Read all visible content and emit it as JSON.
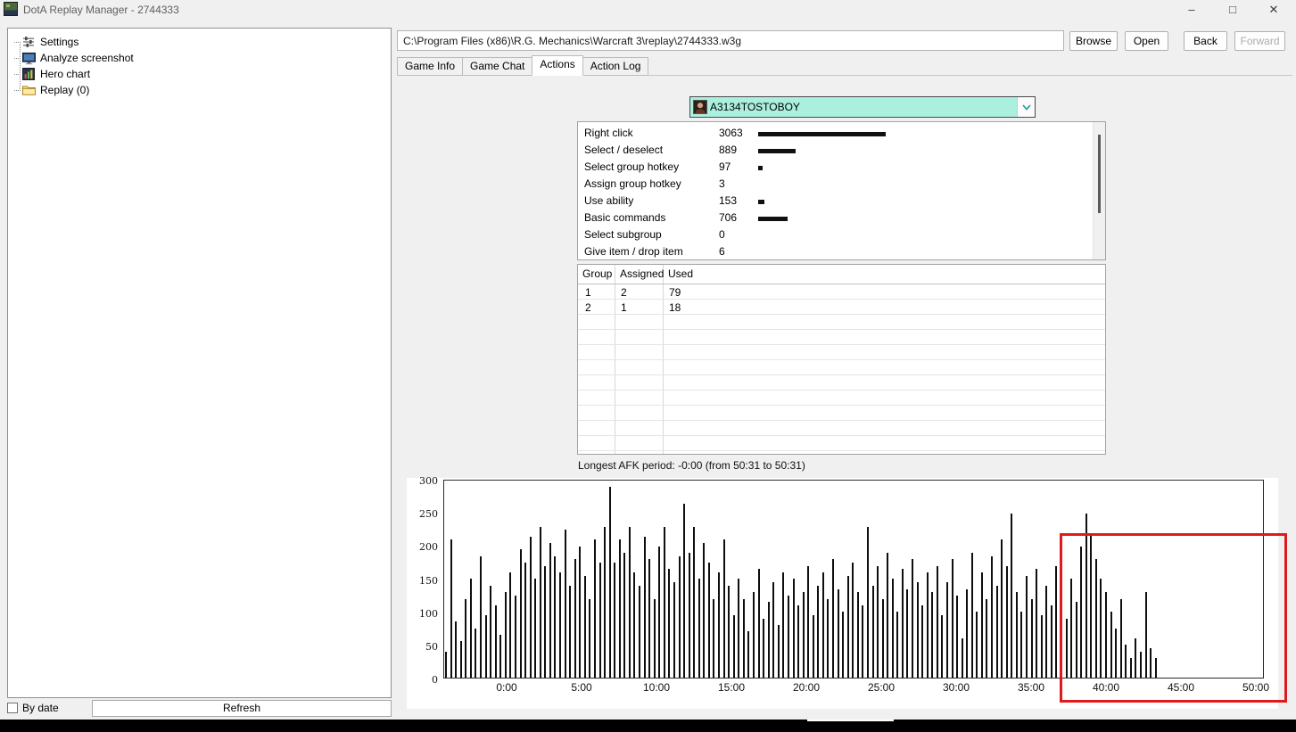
{
  "window": {
    "title": "DotA Replay Manager - 2744333",
    "controls": {
      "minimize": "–",
      "maximize": "□",
      "close": "✕"
    }
  },
  "sidebar": {
    "items": [
      {
        "id": "settings",
        "label": "Settings",
        "icon": "settings-icon"
      },
      {
        "id": "analyze-screenshot",
        "label": "Analyze screenshot",
        "icon": "screenshot-icon"
      },
      {
        "id": "hero-chart",
        "label": "Hero chart",
        "icon": "hero-chart-icon"
      },
      {
        "id": "replay",
        "label": "Replay (0)",
        "icon": "folder-icon"
      }
    ],
    "by_date_label": "By date",
    "refresh_label": "Refresh"
  },
  "toolbar": {
    "path": "C:\\Program Files (x86)\\R.G. Mechanics\\Warcraft 3\\replay\\2744333.w3g",
    "browse_label": "Browse",
    "open_label": "Open",
    "back_label": "Back",
    "forward_label": "Forward"
  },
  "tabs": [
    {
      "label": "Game Info",
      "active": false
    },
    {
      "label": "Game Chat",
      "active": false
    },
    {
      "label": "Actions",
      "active": true
    },
    {
      "label": "Action Log",
      "active": false
    }
  ],
  "player_dropdown": {
    "value": "A3134TOSTOBOY",
    "icon": "player-portrait-icon"
  },
  "actions_list": [
    {
      "label": "Right click",
      "count": 3063
    },
    {
      "label": "Select / deselect",
      "count": 889
    },
    {
      "label": "Select group hotkey",
      "count": 97
    },
    {
      "label": "Assign group hotkey",
      "count": 3
    },
    {
      "label": "Use ability",
      "count": 153
    },
    {
      "label": "Basic commands",
      "count": 706
    },
    {
      "label": "Select subgroup",
      "count": 0
    },
    {
      "label": "Give item / drop item",
      "count": 6
    }
  ],
  "groups_table": {
    "headers": [
      "Group",
      "Assigned",
      "Used"
    ],
    "rows": [
      [
        "1",
        "2",
        "79"
      ],
      [
        "2",
        "1",
        "18"
      ]
    ]
  },
  "afk_text": "Longest AFK period: -0:00 (from 50:31 to 50:31)",
  "chart_data": {
    "type": "bar",
    "ylabel": "",
    "xlabel": "",
    "ylim": [
      0,
      300
    ],
    "yticks": [
      300,
      250,
      200,
      150,
      100,
      50,
      0
    ],
    "xticks": [
      "0:00",
      "5:00",
      "10:00",
      "15:00",
      "20:00",
      "25:00",
      "30:00",
      "35:00",
      "40:00",
      "45:00",
      "50:00"
    ],
    "bar_interval_seconds": 20,
    "x_start_minutes": -4.25,
    "values": [
      40,
      210,
      85,
      55,
      120,
      150,
      75,
      185,
      95,
      140,
      110,
      65,
      130,
      160,
      125,
      195,
      175,
      215,
      150,
      230,
      170,
      205,
      185,
      160,
      225,
      140,
      180,
      200,
      155,
      120,
      210,
      175,
      230,
      290,
      175,
      210,
      190,
      230,
      160,
      140,
      215,
      180,
      120,
      200,
      230,
      165,
      145,
      185,
      265,
      190,
      230,
      150,
      205,
      175,
      120,
      160,
      210,
      140,
      95,
      150,
      120,
      70,
      130,
      165,
      90,
      115,
      145,
      80,
      160,
      125,
      150,
      110,
      130,
      170,
      95,
      140,
      160,
      120,
      180,
      135,
      100,
      155,
      175,
      130,
      110,
      230,
      140,
      170,
      120,
      190,
      150,
      100,
      165,
      135,
      180,
      145,
      110,
      160,
      130,
      170,
      95,
      145,
      180,
      125,
      60,
      135,
      190,
      100,
      160,
      120,
      185,
      140,
      210,
      170,
      250,
      130,
      100,
      155,
      120,
      165,
      95,
      140,
      110,
      170,
      130,
      90,
      150,
      115,
      200,
      250,
      220,
      180,
      150,
      130,
      100,
      75,
      120,
      50,
      30,
      60,
      40,
      130,
      45,
      30,
      0,
      0,
      0,
      0,
      0,
      0,
      0,
      0,
      0,
      0,
      0,
      0,
      0,
      0,
      0,
      0,
      0,
      0,
      0,
      0,
      0
    ],
    "annotation": {
      "shape": "red-box",
      "x_from": "38:00",
      "x_to": "50:30",
      "color": "#e01a1a"
    }
  }
}
